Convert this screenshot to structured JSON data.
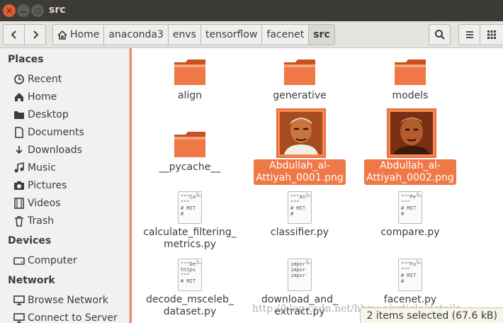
{
  "window": {
    "title": "src"
  },
  "toolbar": {
    "back_icon": "chevron-left-icon",
    "forward_icon": "chevron-right-icon",
    "breadcrumbs": [
      "Home",
      "anaconda3",
      "envs",
      "tensorflow",
      "facenet",
      "src"
    ],
    "search_icon": "search-icon",
    "menu_icon": "hamburger-menu-icon",
    "view_icon": "grid-view-icon"
  },
  "sidebar": {
    "places_heading": "Places",
    "places": [
      {
        "label": "Recent",
        "icon": "clock-icon"
      },
      {
        "label": "Home",
        "icon": "home-icon"
      },
      {
        "label": "Desktop",
        "icon": "desktop-folder-icon"
      },
      {
        "label": "Documents",
        "icon": "document-icon"
      },
      {
        "label": "Downloads",
        "icon": "download-icon"
      },
      {
        "label": "Music",
        "icon": "music-icon"
      },
      {
        "label": "Pictures",
        "icon": "camera-icon"
      },
      {
        "label": "Videos",
        "icon": "film-icon"
      },
      {
        "label": "Trash",
        "icon": "trash-icon"
      }
    ],
    "devices_heading": "Devices",
    "devices": [
      {
        "label": "Computer",
        "icon": "drive-icon"
      }
    ],
    "network_heading": "Network",
    "network": [
      {
        "label": "Browse Network",
        "icon": "network-icon"
      },
      {
        "label": "Connect to Server",
        "icon": "server-icon"
      }
    ]
  },
  "files": [
    {
      "name": "align",
      "type": "folder"
    },
    {
      "name": "generative",
      "type": "folder"
    },
    {
      "name": "models",
      "type": "folder"
    },
    {
      "name": "__pycache__",
      "type": "folder"
    },
    {
      "name": "Abdullah_al-Attiyah_0001.png",
      "type": "image",
      "line1": "Abdullah_al-",
      "line2": "Attiyah_0001.png",
      "selected": true
    },
    {
      "name": "Abdullah_al-Attiyah_0002.png",
      "type": "image",
      "line1": "Abdullah_al-",
      "line2": "Attiyah_0002.png",
      "selected": true
    },
    {
      "name": "calculate_filtering_metrics.py",
      "type": "script",
      "line1": "calculate_filtering_",
      "line2": "metrics.py",
      "preview": "\"\"\"Ca\n\"\"\"\n# MIT\n#"
    },
    {
      "name": "classifier.py",
      "type": "script",
      "line1": "classifier.py",
      "line2": "",
      "preview": "\"\"\"An\n\"\"\"\n# MIT\n#"
    },
    {
      "name": "compare.py",
      "type": "script",
      "line1": "compare.py",
      "line2": "",
      "preview": "\"\"\"Pe\n\"\"\"\n# MIT\n#"
    },
    {
      "name": "decode_msceleb_dataset.py",
      "type": "script",
      "line1": "decode_msceleb_",
      "line2": "dataset.py",
      "preview": "\"\"\"De\nhttps\n\"\"\"\n# MIT"
    },
    {
      "name": "download_and_extract.py",
      "type": "script",
      "line1": "download_and_",
      "line2": "extract.py",
      "preview": "impor\nimpor\nimpor"
    },
    {
      "name": "facenet.py",
      "type": "script",
      "line1": "facenet.py",
      "line2": "",
      "preview": "\"\"\"Fu\n\"\"\"\n# MIT\n#"
    }
  ],
  "status": {
    "text": "2 items selected  (67.6 kB)"
  },
  "watermark": "http://blog.csdn.net/hhmao/article/details",
  "colors": {
    "accent": "#f07746",
    "titlebar": "#3c3b37",
    "folder": "#e8683a"
  }
}
